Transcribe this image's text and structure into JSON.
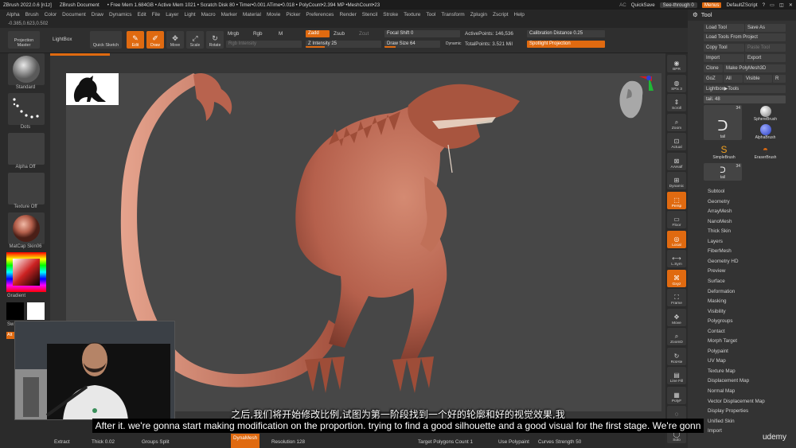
{
  "titlebar": {
    "items": [
      "ZBrush 2022.0.6 [n1z]",
      "ZBrush Document",
      "• Free Mem 1.684GB • Active Mem 1021 • Scratch Disk 80 • Timer•0.001 ATime•0.018 • PolyCount•2.394 MP •MeshCount•23"
    ],
    "ac": "AC",
    "quicksave": "QuickSave",
    "see_through": "See-through 0",
    "menus": "Menus",
    "script": "DefaultZScript"
  },
  "menubar": [
    "Alpha",
    "Brush",
    "Color",
    "Document",
    "Draw",
    "Dynamics",
    "Edit",
    "File",
    "Layer",
    "Light",
    "Macro",
    "Marker",
    "Material",
    "Movie",
    "Picker",
    "Preferences",
    "Render",
    "Stencil",
    "Stroke",
    "Texture",
    "Tool",
    "Transform",
    "Zplugin",
    "Zscript",
    "Help"
  ],
  "coords": "-0.385,0.623,0.502",
  "toolbar": {
    "projection_master": "Projection Master",
    "lightbox": "LightBox",
    "quick_sketch": "Quick Sketch",
    "edit": "Edit",
    "draw": "Draw",
    "move": "Move",
    "scale": "Scale",
    "rotate": "Rotate",
    "mrgb": "Mrgb",
    "rgb": "Rgb",
    "m": "M",
    "rgb_intensity": "Rgb Intensity",
    "zadd": "Zadd",
    "zsub": "Zsub",
    "zcut": "Zcut",
    "z_intensity": "Z Intensity 25",
    "focal_shift": "Focal Shift 0",
    "draw_size": "Draw Size 64",
    "dynamic": "Dynamic",
    "active_points": "ActivePoints: 146,536",
    "total_points": "TotalPoints: 3.521 Mil",
    "calibration": "Calibration Distance 0.25",
    "spotlight": "Spotlight Projection"
  },
  "left_shelf": {
    "standard": "Standard",
    "dots": "Dots",
    "alpha_off": "Alpha Off",
    "texture_off": "Texture Off",
    "material": "MatCap Skin06",
    "gradient": "Gradient",
    "switch_color": "Sw",
    "alternate": "Alt"
  },
  "right_shelf": [
    "BPR",
    "SPix 3",
    "Scroll",
    "Zoom",
    "Actual",
    "AAHalf",
    "Dynamic",
    "Persp",
    "Floor",
    "Local",
    "L.Sym",
    "Gxyz",
    "Frame",
    "Move",
    "ZoomD",
    "RotAte",
    "Line Fill",
    "PolyF",
    "Transp",
    "Solo"
  ],
  "tool_panel": {
    "title": "Tool",
    "load_tool": "Load Tool",
    "save_as": "Save As",
    "load_from_project": "Load Tools From Project",
    "copy_tool": "Copy Tool",
    "paste_tool": "Paste Tool",
    "import": "Import",
    "export": "Export",
    "clone": "Clone",
    "make_polymesh": "Make PolyMesh3D",
    "goz": "GoZ",
    "all": "All",
    "visible": "Visible",
    "r": "R",
    "lightbox_tools": "Lightbox▶Tools",
    "current_tool": "tail. 48",
    "thumb_tail": "tail",
    "thumb_count": "34",
    "sphere_brush": "SphereBrush",
    "alpha_brush": "AlphaBrush",
    "simple_brush": "SimpleBrush",
    "eraser_brush": "EraserBrush",
    "thumb_tail_small": "tail",
    "thumb_count_small": "34",
    "subpalettes": [
      "Subtool",
      "Geometry",
      "ArrayMesh",
      "NanoMesh",
      "Thick Skin",
      "Layers",
      "FiberMesh",
      "Geometry HD",
      "Preview",
      "Surface",
      "Deformation",
      "Masking",
      "Visibility",
      "Polygroups",
      "Contact",
      "Morph Target",
      "Polypaint",
      "UV Map",
      "Texture Map",
      "Displacement Map",
      "Normal Map",
      "Vector Displacement Map",
      "Display Properties",
      "Unified Skin",
      "Import"
    ]
  },
  "bottombar": {
    "extract": "Extract",
    "thick": "Thick 0.02",
    "groups_split": "Groups Split",
    "dynamesh": "DynaMesh",
    "resolution": "Resolution 128",
    "target_polygons": "Target Polygons Count 1",
    "use_polypaint": "Use Polypaint",
    "curves_strength": "Curves Strength 50"
  },
  "subtitles": {
    "chinese": "之后,我们将开始修改比例,试图为第一阶段找到一个好的轮廓和好的视觉效果,我",
    "english": "After it. we're gonna start making modification on the proportion. trying to find a good silhouette and a good visual for the first stage. We're gonn"
  },
  "watermark": "udemy",
  "colors": {
    "accent": "#e06a10",
    "model": "#b5604c",
    "viewport": "#474747"
  }
}
